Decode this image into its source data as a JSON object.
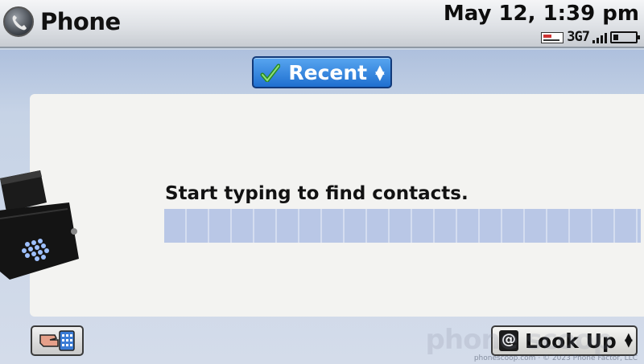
{
  "statusbar": {
    "app_title": "Phone",
    "app_icon": "phone-handset-icon",
    "datetime": "May 12, 1:39 pm",
    "network": "3G",
    "network_mark": "7",
    "signal_bars": 4,
    "battery_level": 0.2
  },
  "toolbar": {
    "recent_label": "Recent",
    "recent_icon": "check-handset-icon",
    "recent_arrows": [
      "▲",
      "▼"
    ]
  },
  "main": {
    "hint": "Start typing to find contacts.",
    "entry_value": ""
  },
  "bottom": {
    "dialpad_icon": "hand-dialpad-icon",
    "lookup_label": "Look Up",
    "lookup_icon": "at-sign-icon",
    "lookup_at": "@",
    "lookup_arrows": [
      "▲",
      "▼"
    ]
  },
  "watermark": {
    "logo": "phone scoop",
    "text": "phonescoop.com · © 2023 Phone Factor, LLC"
  },
  "colors": {
    "accent": "#1f6fd0",
    "entry_fill": "#b9c7e6"
  }
}
